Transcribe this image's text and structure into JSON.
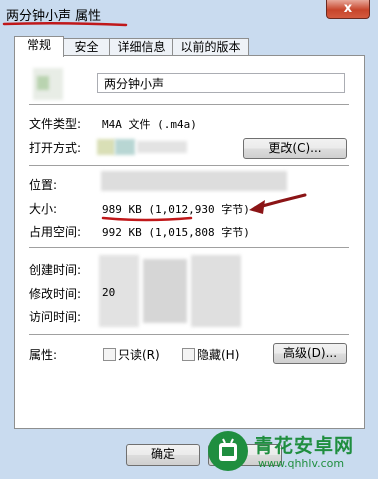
{
  "window": {
    "title": "两分钟小声 属性",
    "close_glyph": "x"
  },
  "tabs": [
    {
      "label": "常规",
      "active": true
    },
    {
      "label": "安全",
      "active": false
    },
    {
      "label": "详细信息",
      "active": false
    },
    {
      "label": "以前的版本",
      "active": false
    }
  ],
  "general": {
    "file_name": "两分钟小声",
    "file_type_label": "文件类型:",
    "file_type_value": "M4A 文件 (.m4a)",
    "open_with_label": "打开方式:",
    "change_button": "更改(C)...",
    "location_label": "位置:",
    "size_label": "大小:",
    "size_value": "989 KB (1,012,930 字节)",
    "size_on_disk_label": "占用空间:",
    "size_on_disk_value": "992 KB (1,015,808 字节)",
    "created_label": "创建时间:",
    "modified_label": "修改时间:",
    "modified_value_partial": "20",
    "accessed_label": "访问时间:",
    "attributes_label": "属性:",
    "readonly_label": "只读(R)",
    "hidden_label": "隐藏(H)",
    "advanced_button": "高级(D)..."
  },
  "footer": {
    "ok_button": "确定"
  },
  "watermark": {
    "title": "青花安卓网",
    "url": "www.qhhlv.com"
  },
  "colors": {
    "annotation_red": "#c0181a",
    "window_frame": "#c9dbef"
  }
}
